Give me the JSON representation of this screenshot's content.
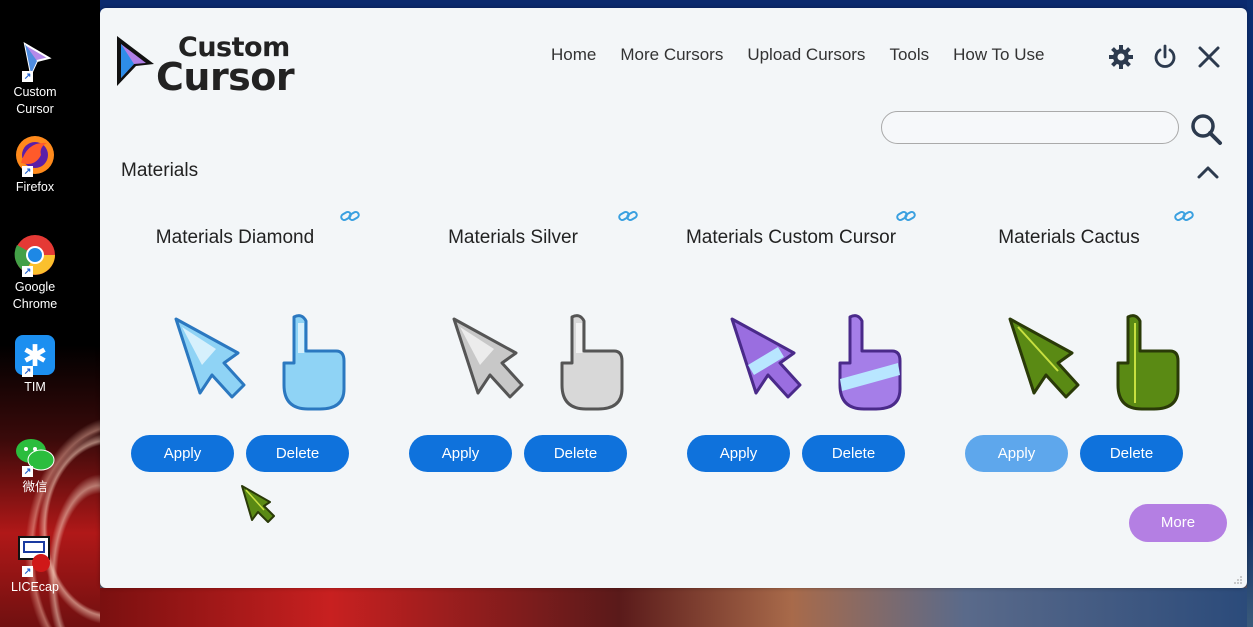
{
  "desktop": {
    "icons": [
      {
        "name": "Custom\nCursor",
        "line1": "Custom",
        "line2": "Cursor"
      },
      {
        "line1": "Firefox",
        "line2": ""
      },
      {
        "line1": "Google",
        "line2": "Chrome"
      },
      {
        "line1": "TIM",
        "line2": ""
      },
      {
        "line1": "微信",
        "line2": ""
      },
      {
        "line1": "LICEcap",
        "line2": ""
      }
    ]
  },
  "app": {
    "logo_top": "Custom",
    "logo_bottom": "Cursor",
    "nav": [
      "Home",
      "More Cursors",
      "Upload Cursors",
      "Tools",
      "How To Use"
    ],
    "search_placeholder": "",
    "section_title": "Materials",
    "cards": [
      {
        "title": "Materials Diamond",
        "apply": "Apply",
        "delete": "Delete",
        "color": "#7fc8f2"
      },
      {
        "title": "Materials Silver",
        "apply": "Apply",
        "delete": "Delete",
        "color": "#c8c8c8"
      },
      {
        "title": "Materials Custom Cursor",
        "apply": "Apply",
        "delete": "Delete",
        "color": "#9a6ee0"
      },
      {
        "title": "Materials Cactus",
        "apply": "Apply",
        "delete": "Delete",
        "color": "#5a8a14"
      }
    ],
    "more": "More",
    "accent": "#0f72dc",
    "more_color": "#b47fe3"
  }
}
